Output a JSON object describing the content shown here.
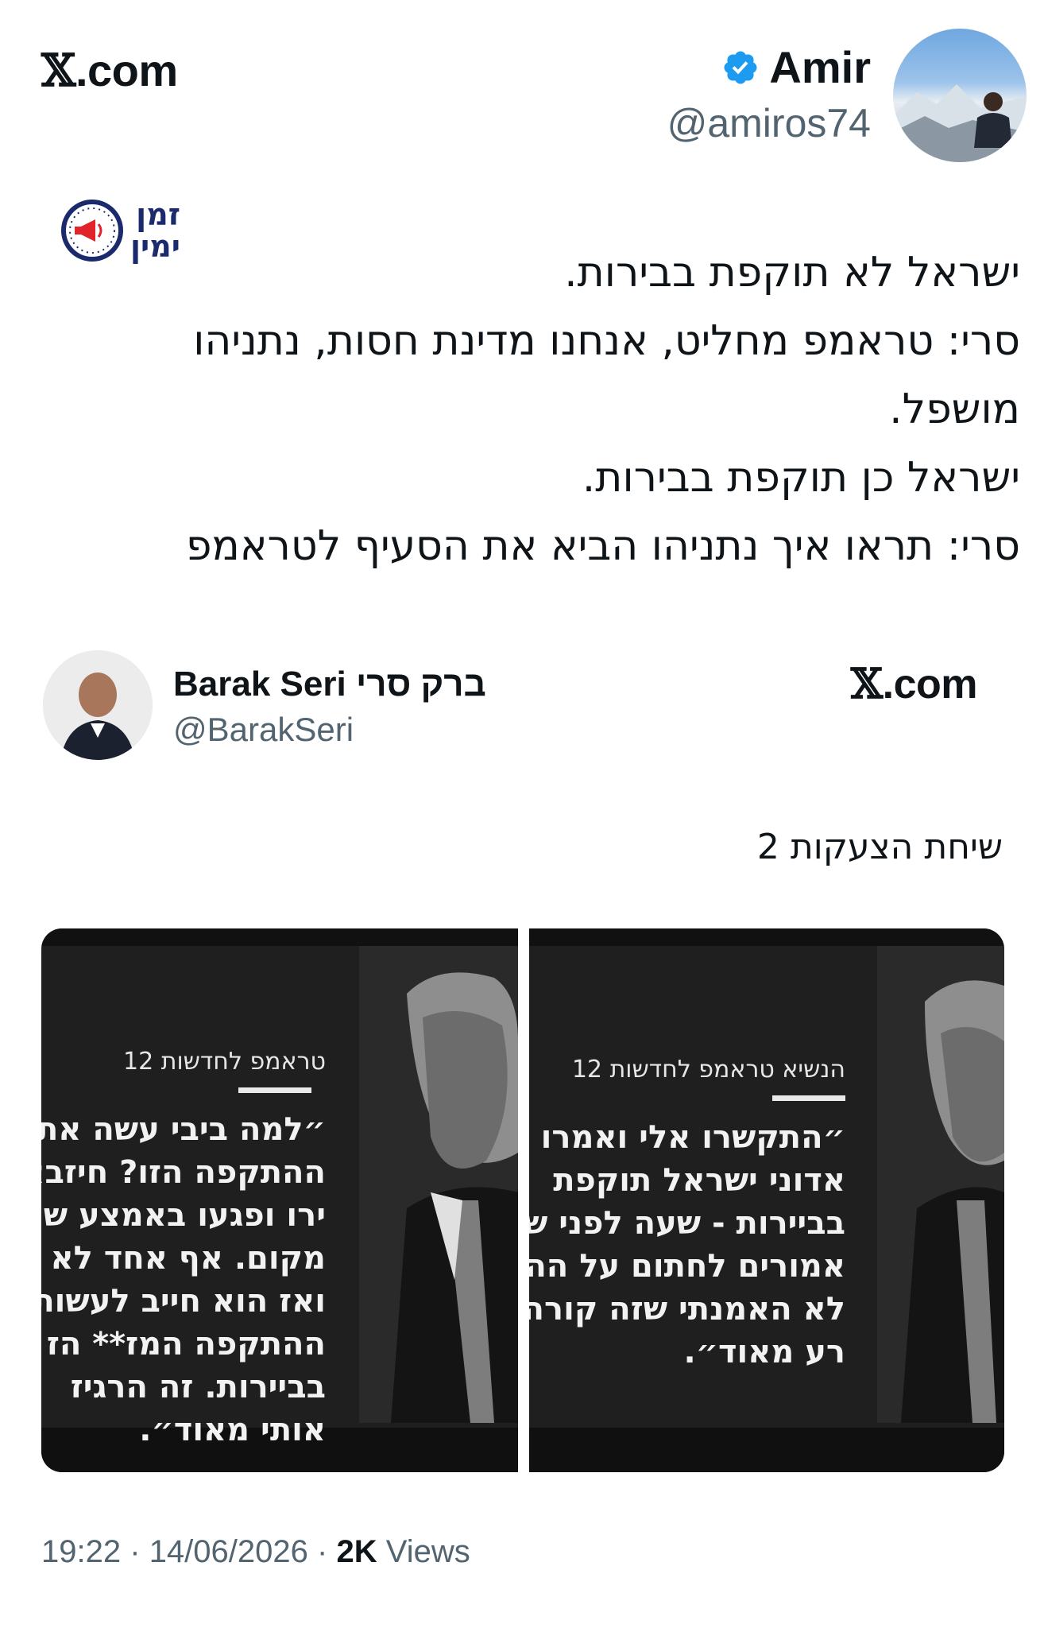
{
  "top_logo": {
    "x": "𝕏",
    "suffix": ".com"
  },
  "author": {
    "name": "Amir",
    "handle": "@amiros74"
  },
  "stamp": {
    "line1": "זמן",
    "line2": "ימין"
  },
  "tweet": {
    "lines": [
      "ישראל לא תוקפת בבירות.",
      "סרי: טראמפ מחליט, אנחנו מדינת חסות, נתניהו",
      "מושפל.",
      "ישראל כן תוקפת בבירות.",
      "סרי: תראו איך נתניהו הביא את הסעיף לטראמפ"
    ]
  },
  "quoted": {
    "name": "Barak Seri ברק סרי",
    "handle": "@BarakSeri",
    "logo": {
      "x": "𝕏",
      "suffix": ".com"
    },
    "caption": "שיחת הצעקות 2"
  },
  "media": {
    "left": {
      "heading": "טראמפ לחדשות 12",
      "quote_lines": [
        "״למה ביבי עשה את",
        "ההתקפה הזו? חיזבא",
        "ירו ופגעו באמצע שו",
        "מקום. אף אחד לא נ",
        "ואז הוא חייב לעשות",
        "ההתקפה המז** הז",
        "בביירות. זה הרגיז",
        "אותי מאוד״."
      ]
    },
    "right": {
      "heading": "הנשיא טראמפ לחדשות 12",
      "quote_lines": [
        "״התקשרו אלי ואמרו לי",
        "אדוני ישראל תוקפת",
        "בביירות - שעה לפני ש",
        "אמורים לחתום על הה",
        "לא האמנתי שזה קורה",
        "רע מאוד״."
      ]
    }
  },
  "footer": {
    "time": "19:22",
    "date": "14/06/2026",
    "views_count": "2K",
    "views_label": "Views",
    "sep": "·"
  },
  "colors": {
    "verified": "#1d9bf0",
    "text": "#0f1419",
    "muted": "#536471",
    "stamp": "#1a2a6c",
    "stamp_accent": "#e0242a"
  }
}
